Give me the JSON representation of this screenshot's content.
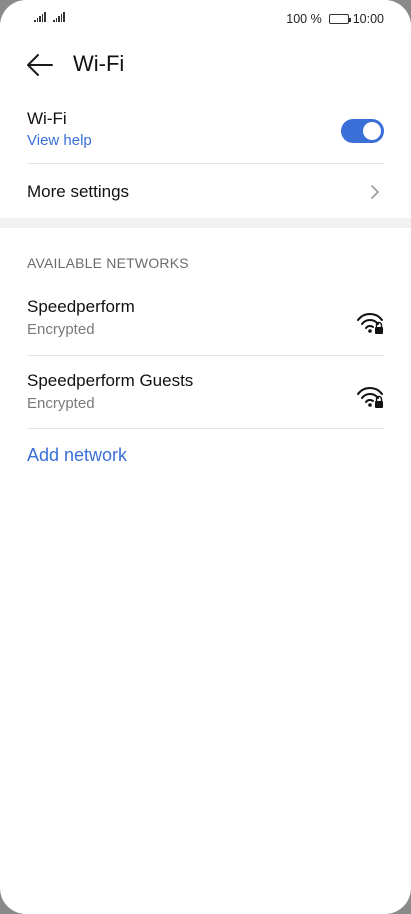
{
  "status_bar": {
    "battery_percent": "100 %",
    "battery_level": 1.0,
    "time": "10:00"
  },
  "header": {
    "title": "Wi-Fi"
  },
  "wifi_toggle": {
    "label": "Wi-Fi",
    "help_link": "View help",
    "enabled": true
  },
  "more_settings": {
    "label": "More settings"
  },
  "available_networks": {
    "heading": "AVAILABLE NETWORKS",
    "networks": [
      {
        "name": "Speedperform",
        "security": "Encrypted",
        "icon": "wifi-locked-icon"
      },
      {
        "name": "Speedperform Guests",
        "security": "Encrypted",
        "icon": "wifi-locked-icon"
      }
    ]
  },
  "add_network": {
    "label": "Add network"
  },
  "colors": {
    "accent": "#3a6fd8",
    "divider": "#e6e6e6",
    "secondary_text": "#7a7a7a"
  }
}
